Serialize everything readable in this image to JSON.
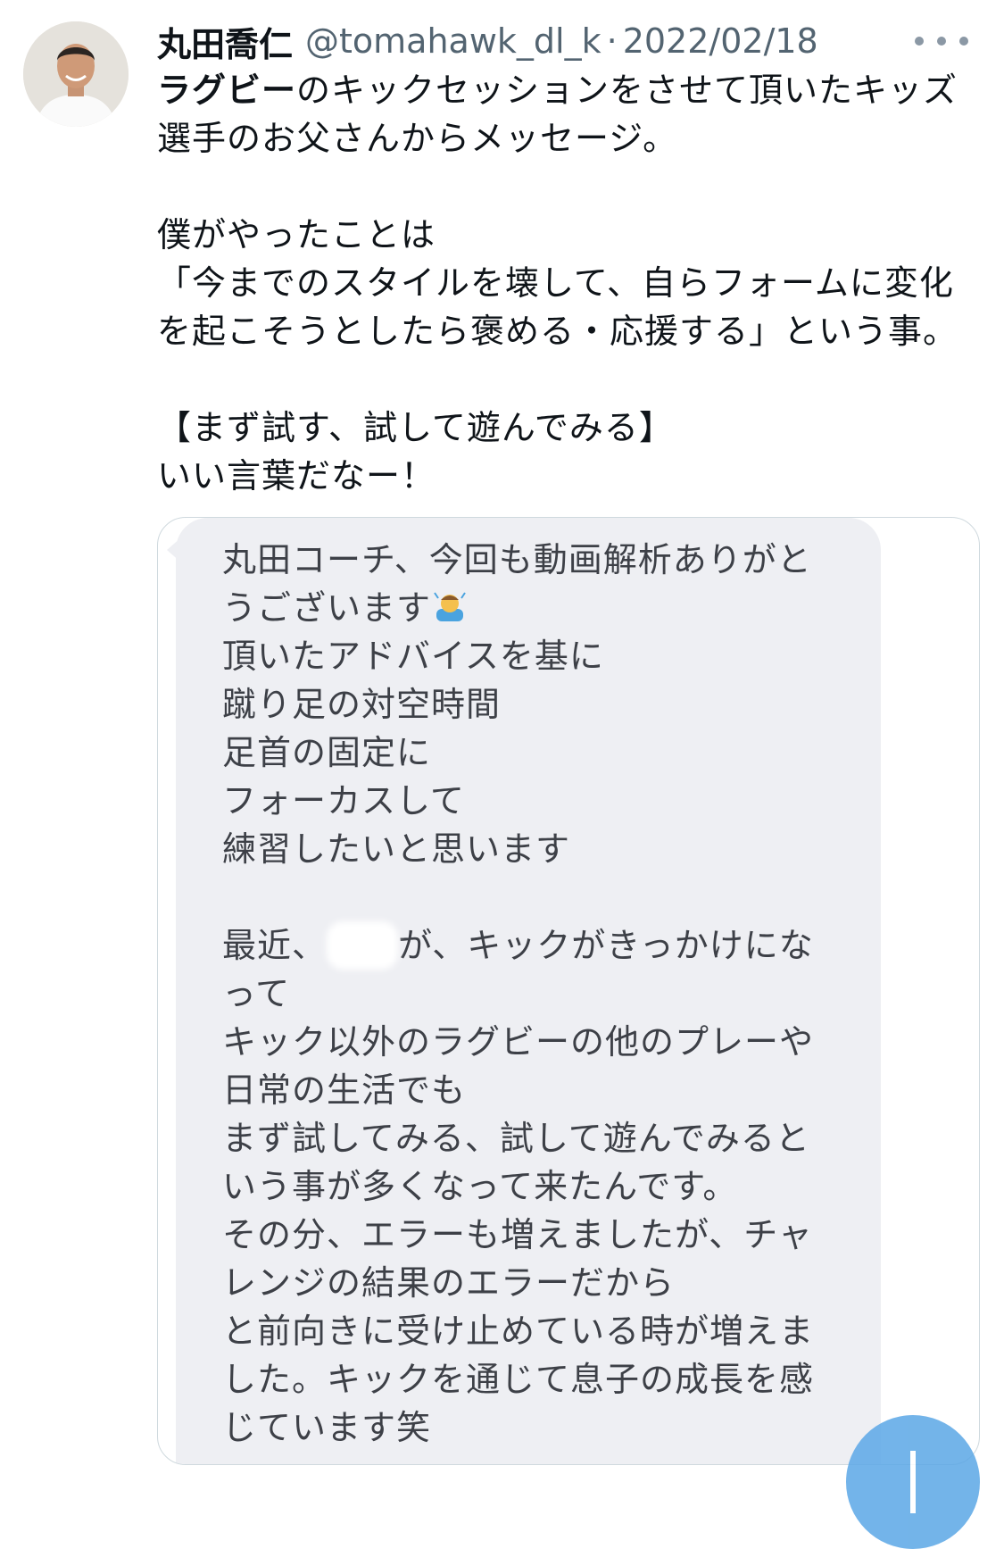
{
  "tweet": {
    "author_name": "丸田喬仁",
    "handle": "@tomahawk_dl_k",
    "separator": "·",
    "date": "2022/02/18",
    "text_lines": {
      "l1_hashtag": "ラグビー",
      "l1_rest": "のキックセッションをさせて頂いたキッズ",
      "l2": "選手のお父さんからメッセージ。",
      "l3": "僕がやったことは",
      "l4": "「今までのスタイルを壊して、自らフォームに変化",
      "l5": "を起こそうとしたら褒める・応援する」という事。",
      "l6": "【まず試す、試して遊んでみる】",
      "l7": "いい言葉だなー！"
    }
  },
  "avatar_icon": "person-photo",
  "more_icon": "more-dots-icon",
  "message": {
    "l1": "丸田コーチ、今回も動画解析ありがと",
    "l2": "うございます",
    "l3": "頂いたアドバイスを基に",
    "l4": "蹴り足の対空時間",
    "l5": "足首の固定に",
    "l6": "フォーカスして",
    "l7": "練習したいと思います",
    "l8_start": "最近、",
    "l8_end": "が、キックがきっかけにな",
    "l9": "って",
    "l10": "キック以外のラグビーの他のプレーや",
    "l11": "日常の生活でも",
    "l12": "まず試してみる、試して遊んでみると",
    "l13": "いう事が多くなって来たんです。",
    "l14": "その分、エラーも増えましたが、チャ",
    "l15": "レンジの結果のエラーだから",
    "l16": "と前向きに受け止めている時が増えま",
    "l17": "した。キックを通じて息子の成長を感",
    "l18": "じています笑"
  },
  "colors": {
    "accent": "#5ba7e6",
    "bubble": "#eeeff3",
    "secondary_text": "#536471"
  }
}
